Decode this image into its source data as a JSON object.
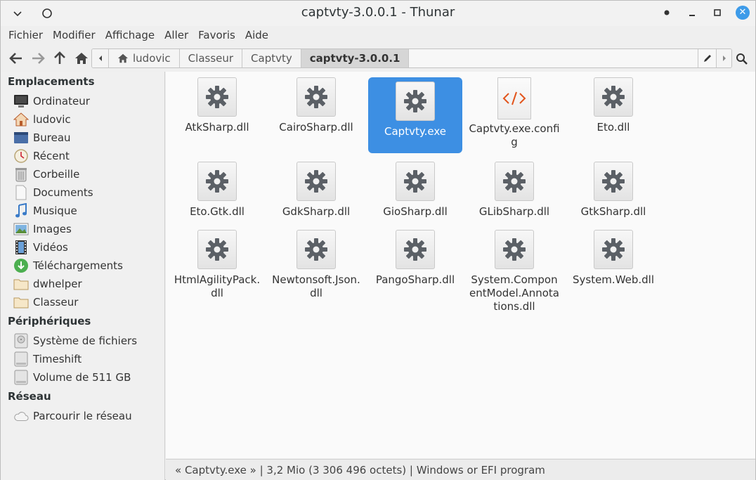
{
  "window": {
    "title": "captvty-3.0.0.1 - Thunar",
    "accent": "#3d8fe3"
  },
  "menu": [
    "Fichier",
    "Modifier",
    "Affichage",
    "Aller",
    "Favoris",
    "Aide"
  ],
  "breadcrumbs": [
    "ludovic",
    "Classeur",
    "Captvty",
    "captvty-3.0.0.1"
  ],
  "sidebar": {
    "places_header": "Emplacements",
    "places": [
      {
        "label": "Ordinateur",
        "icon": "computer-icon"
      },
      {
        "label": "ludovic",
        "icon": "home-icon"
      },
      {
        "label": "Bureau",
        "icon": "desktop-icon"
      },
      {
        "label": "Récent",
        "icon": "recent-icon"
      },
      {
        "label": "Corbeille",
        "icon": "trash-icon"
      },
      {
        "label": "Documents",
        "icon": "document-icon"
      },
      {
        "label": "Musique",
        "icon": "music-icon"
      },
      {
        "label": "Images",
        "icon": "image-icon"
      },
      {
        "label": "Vidéos",
        "icon": "video-icon"
      },
      {
        "label": "Téléchargements",
        "icon": "download-icon"
      },
      {
        "label": "dwhelper",
        "icon": "folder-icon"
      },
      {
        "label": "Classeur",
        "icon": "folder-icon"
      }
    ],
    "devices_header": "Périphériques",
    "devices": [
      {
        "label": "Système de fichiers",
        "icon": "drive-icon"
      },
      {
        "label": "Timeshift",
        "icon": "drive-icon"
      },
      {
        "label": "Volume de 511 GB",
        "icon": "drive-icon"
      }
    ],
    "network_header": "Réseau",
    "network": [
      {
        "label": "Parcourir le réseau",
        "icon": "network-icon"
      }
    ]
  },
  "files": [
    {
      "name": "AtkSharp.dll",
      "icon": "gear-icon"
    },
    {
      "name": "CairoSharp.dll",
      "icon": "gear-icon"
    },
    {
      "name": "Captvty.exe",
      "icon": "gear-icon",
      "selected": true
    },
    {
      "name": "Captvty.exe.config",
      "icon": "xml-icon"
    },
    {
      "name": "Eto.dll",
      "icon": "gear-icon"
    },
    {
      "name": "Eto.Gtk.dll",
      "icon": "gear-icon"
    },
    {
      "name": "GdkSharp.dll",
      "icon": "gear-icon"
    },
    {
      "name": "GioSharp.dll",
      "icon": "gear-icon"
    },
    {
      "name": "GLibSharp.dll",
      "icon": "gear-icon"
    },
    {
      "name": "GtkSharp.dll",
      "icon": "gear-icon"
    },
    {
      "name": "HtmlAgilityPack.dll",
      "icon": "gear-icon"
    },
    {
      "name": "Newtonsoft.Json.dll",
      "icon": "gear-icon"
    },
    {
      "name": "PangoSharp.dll",
      "icon": "gear-icon"
    },
    {
      "name": "System.ComponentModel.Annotations.dll",
      "icon": "gear-icon"
    },
    {
      "name": "System.Web.dll",
      "icon": "gear-icon"
    }
  ],
  "status": "« Captvty.exe » | 3,2 Mio (3 306 496 octets) | Windows or EFI program"
}
